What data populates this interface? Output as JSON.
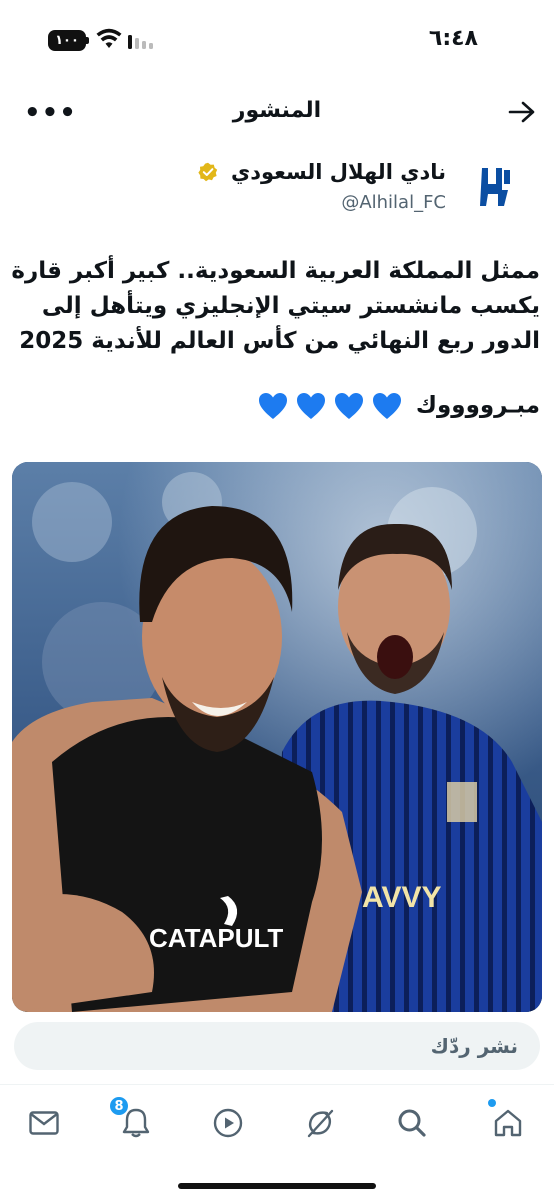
{
  "status_bar": {
    "time": "٦:٤٨",
    "battery": "١٠٠",
    "icons": [
      "battery-icon",
      "wifi-icon",
      "signal-icon"
    ]
  },
  "header": {
    "title": "المنشور",
    "more_icon": "more-icon",
    "back_icon": "arrow-icon"
  },
  "author": {
    "name": "نادي الهلال السعودي",
    "handle": "@Alhilal_FC",
    "verified_color": "#e2b719",
    "logo_color": "#0b4ea2"
  },
  "post": {
    "lines": [
      "ممثل المملكة العربية السعودية.. كبير أكبر قارة",
      "يكسب مانشستر سيتي الإنجليزي ويتأهل إلى",
      "الدور ربع النهائي من كأس العالم للأندية 2025"
    ],
    "congrats": "مبـرووووك",
    "hearts_count": 4,
    "heart_color": "#1d7bf0"
  },
  "media": {
    "jersey_text": "CATAPULT",
    "sponsor_text": "AVVY"
  },
  "reply": {
    "placeholder": "نشر ردّك"
  },
  "nav": {
    "items": [
      "mail-icon",
      "bell-icon",
      "play-icon",
      "grok-icon",
      "search-icon",
      "home-icon"
    ],
    "notification_count": "8",
    "accent": "#1d9bf0"
  }
}
